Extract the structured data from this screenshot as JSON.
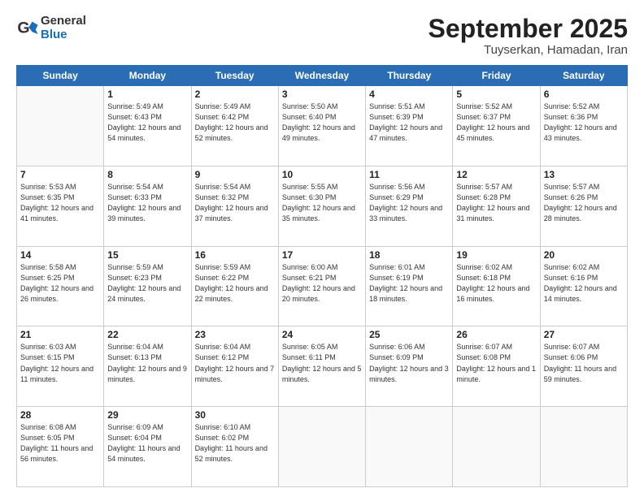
{
  "logo": {
    "text_general": "General",
    "text_blue": "Blue"
  },
  "header": {
    "month": "September 2025",
    "location": "Tuyserkan, Hamadan, Iran"
  },
  "weekdays": [
    "Sunday",
    "Monday",
    "Tuesday",
    "Wednesday",
    "Thursday",
    "Friday",
    "Saturday"
  ],
  "weeks": [
    [
      {
        "day": null
      },
      {
        "day": "1",
        "sunrise": "5:49 AM",
        "sunset": "6:43 PM",
        "daylight": "12 hours and 54 minutes."
      },
      {
        "day": "2",
        "sunrise": "5:49 AM",
        "sunset": "6:42 PM",
        "daylight": "12 hours and 52 minutes."
      },
      {
        "day": "3",
        "sunrise": "5:50 AM",
        "sunset": "6:40 PM",
        "daylight": "12 hours and 49 minutes."
      },
      {
        "day": "4",
        "sunrise": "5:51 AM",
        "sunset": "6:39 PM",
        "daylight": "12 hours and 47 minutes."
      },
      {
        "day": "5",
        "sunrise": "5:52 AM",
        "sunset": "6:37 PM",
        "daylight": "12 hours and 45 minutes."
      },
      {
        "day": "6",
        "sunrise": "5:52 AM",
        "sunset": "6:36 PM",
        "daylight": "12 hours and 43 minutes."
      }
    ],
    [
      {
        "day": "7",
        "sunrise": "5:53 AM",
        "sunset": "6:35 PM",
        "daylight": "12 hours and 41 minutes."
      },
      {
        "day": "8",
        "sunrise": "5:54 AM",
        "sunset": "6:33 PM",
        "daylight": "12 hours and 39 minutes."
      },
      {
        "day": "9",
        "sunrise": "5:54 AM",
        "sunset": "6:32 PM",
        "daylight": "12 hours and 37 minutes."
      },
      {
        "day": "10",
        "sunrise": "5:55 AM",
        "sunset": "6:30 PM",
        "daylight": "12 hours and 35 minutes."
      },
      {
        "day": "11",
        "sunrise": "5:56 AM",
        "sunset": "6:29 PM",
        "daylight": "12 hours and 33 minutes."
      },
      {
        "day": "12",
        "sunrise": "5:57 AM",
        "sunset": "6:28 PM",
        "daylight": "12 hours and 31 minutes."
      },
      {
        "day": "13",
        "sunrise": "5:57 AM",
        "sunset": "6:26 PM",
        "daylight": "12 hours and 28 minutes."
      }
    ],
    [
      {
        "day": "14",
        "sunrise": "5:58 AM",
        "sunset": "6:25 PM",
        "daylight": "12 hours and 26 minutes."
      },
      {
        "day": "15",
        "sunrise": "5:59 AM",
        "sunset": "6:23 PM",
        "daylight": "12 hours and 24 minutes."
      },
      {
        "day": "16",
        "sunrise": "5:59 AM",
        "sunset": "6:22 PM",
        "daylight": "12 hours and 22 minutes."
      },
      {
        "day": "17",
        "sunrise": "6:00 AM",
        "sunset": "6:21 PM",
        "daylight": "12 hours and 20 minutes."
      },
      {
        "day": "18",
        "sunrise": "6:01 AM",
        "sunset": "6:19 PM",
        "daylight": "12 hours and 18 minutes."
      },
      {
        "day": "19",
        "sunrise": "6:02 AM",
        "sunset": "6:18 PM",
        "daylight": "12 hours and 16 minutes."
      },
      {
        "day": "20",
        "sunrise": "6:02 AM",
        "sunset": "6:16 PM",
        "daylight": "12 hours and 14 minutes."
      }
    ],
    [
      {
        "day": "21",
        "sunrise": "6:03 AM",
        "sunset": "6:15 PM",
        "daylight": "12 hours and 11 minutes."
      },
      {
        "day": "22",
        "sunrise": "6:04 AM",
        "sunset": "6:13 PM",
        "daylight": "12 hours and 9 minutes."
      },
      {
        "day": "23",
        "sunrise": "6:04 AM",
        "sunset": "6:12 PM",
        "daylight": "12 hours and 7 minutes."
      },
      {
        "day": "24",
        "sunrise": "6:05 AM",
        "sunset": "6:11 PM",
        "daylight": "12 hours and 5 minutes."
      },
      {
        "day": "25",
        "sunrise": "6:06 AM",
        "sunset": "6:09 PM",
        "daylight": "12 hours and 3 minutes."
      },
      {
        "day": "26",
        "sunrise": "6:07 AM",
        "sunset": "6:08 PM",
        "daylight": "12 hours and 1 minute."
      },
      {
        "day": "27",
        "sunrise": "6:07 AM",
        "sunset": "6:06 PM",
        "daylight": "11 hours and 59 minutes."
      }
    ],
    [
      {
        "day": "28",
        "sunrise": "6:08 AM",
        "sunset": "6:05 PM",
        "daylight": "11 hours and 56 minutes."
      },
      {
        "day": "29",
        "sunrise": "6:09 AM",
        "sunset": "6:04 PM",
        "daylight": "11 hours and 54 minutes."
      },
      {
        "day": "30",
        "sunrise": "6:10 AM",
        "sunset": "6:02 PM",
        "daylight": "11 hours and 52 minutes."
      },
      {
        "day": null
      },
      {
        "day": null
      },
      {
        "day": null
      },
      {
        "day": null
      }
    ]
  ]
}
